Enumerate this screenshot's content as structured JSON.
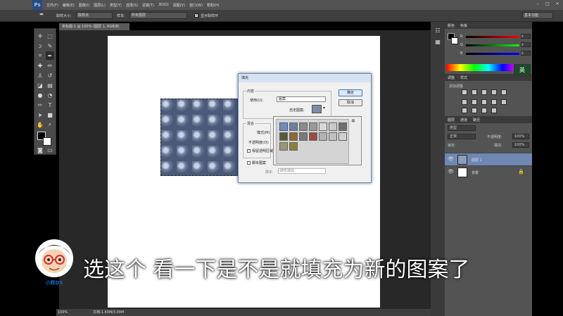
{
  "menubar": {
    "logo": "Ps",
    "items": [
      "文件(F)",
      "编辑(E)",
      "图像(I)",
      "图层(L)",
      "类型(Y)",
      "选择(S)",
      "滤镜(T)",
      "3D(D)",
      "视图(V)",
      "窗口(W)",
      "帮助(H)"
    ],
    "window_controls": [
      "–",
      "□",
      "×"
    ]
  },
  "optbar": {
    "sample_size_label": "取样大小:",
    "sample_size_value": "取样点",
    "sample_label": "样本:",
    "sample_value": "所有图层",
    "show_ring_label": "显示取样环",
    "workspace": "基本功能"
  },
  "document": {
    "tab_title": "未标题-1 @ 100% (图层 1, RGB/8)",
    "status_zoom": "100%",
    "status_doc": "文档:1.83M/3.00M"
  },
  "panels": {
    "color_tab": "颜色",
    "color_tab2": "色板",
    "adjust_tab": "调整",
    "adjust_tab2": "样式",
    "adjust_hint": "添加调整",
    "layers_tabs": [
      "图层",
      "通道",
      "路径"
    ],
    "kind_label": "类型",
    "normal_label": "正常",
    "opacity_label": "不透明度:",
    "opacity_value": "100%",
    "lock_label": "锁定:",
    "fill_label": "填充:",
    "fill_value": "100%",
    "layers": [
      {
        "name": "图层 1"
      },
      {
        "name": "背景"
      }
    ],
    "slider_labels": [
      "R",
      "G",
      "B"
    ],
    "slider_values": [
      "0",
      "0",
      "0"
    ],
    "ime_badge": "英"
  },
  "dialog": {
    "title": "填充",
    "content_group": "内容",
    "use_label": "使用(U):",
    "use_value": "图案",
    "custom_pattern_label": "自定图案:",
    "blend_group": "混合",
    "mode_label": "模式(M):",
    "opacity_label": "不透明度(O):",
    "preserve_label": "保留透明区域(P)",
    "script_label": "脚本图案",
    "script_sub_label": "脚本:",
    "script_value": "砖形填充",
    "ok_label": "确定",
    "cancel_label": "取消"
  },
  "subtitle": "选这个 看一下是不是就填充为新的图案了",
  "avatar": {
    "caption": "小辉DS"
  },
  "colors": {
    "menubar_bg": "#535353",
    "panel_bg": "#535353",
    "canvas_bg": "#282828",
    "accent": "#3a78c3"
  }
}
